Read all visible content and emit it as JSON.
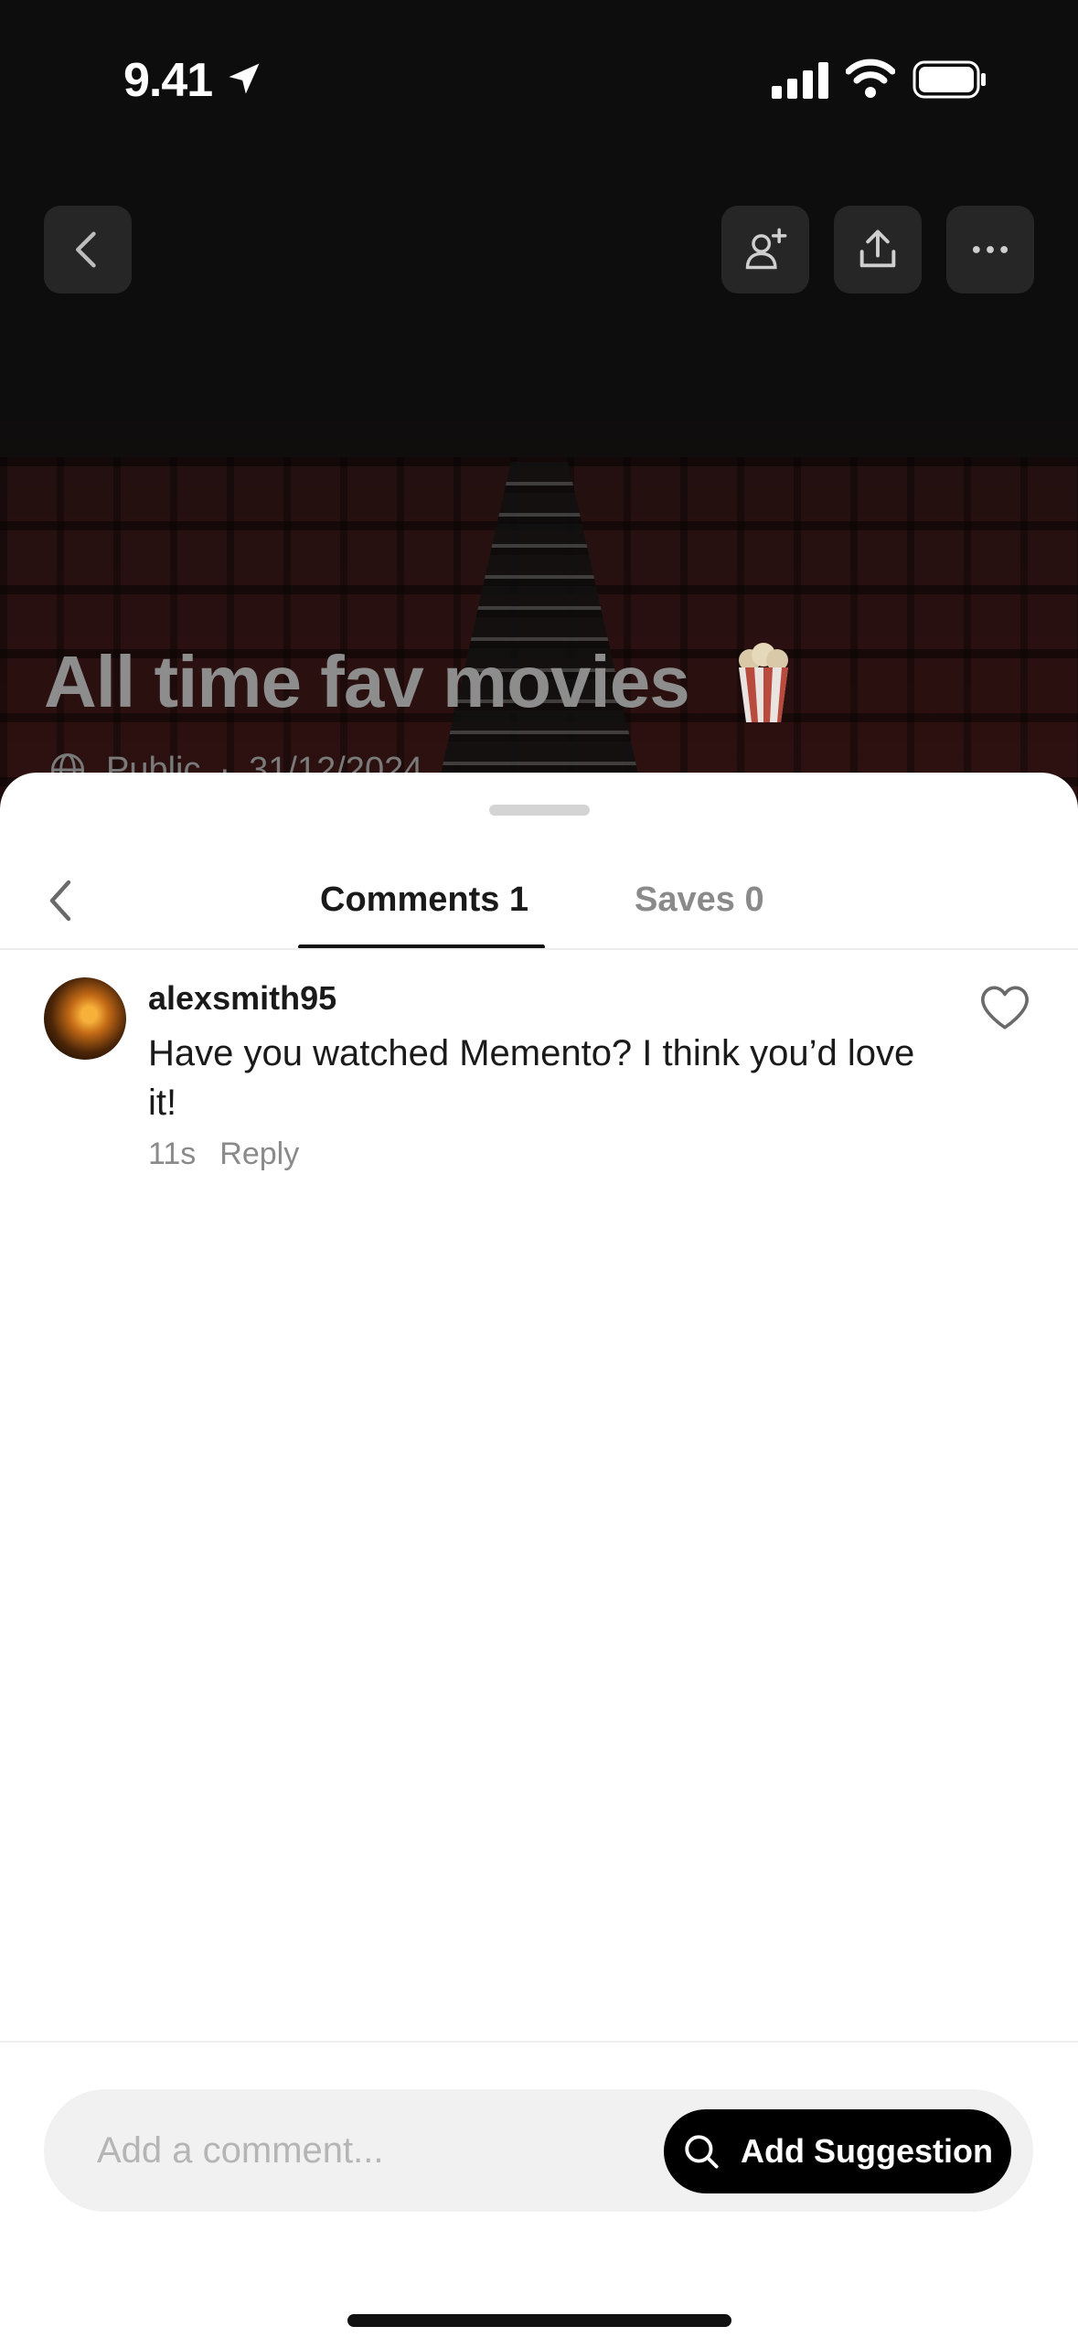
{
  "status_bar": {
    "time": "9.41"
  },
  "hero": {
    "title": "All time fav movies",
    "visibility": "Public",
    "date": "31/12/2024",
    "icons": [
      "back-icon",
      "add-person-icon",
      "share-icon",
      "more-icon",
      "popcorn-icon",
      "globe-icon"
    ]
  },
  "sheet": {
    "tabs": [
      {
        "label": "Comments 1",
        "active": true
      },
      {
        "label": "Saves 0",
        "active": false
      }
    ],
    "comments": [
      {
        "username": "alexsmith95",
        "text": "Have you watched Memento? I think you’d love it!",
        "age": "11s",
        "reply_label": "Reply"
      }
    ],
    "composer": {
      "placeholder": "Add a comment...",
      "suggest_label": "Add Suggestion"
    }
  },
  "colors": {
    "accent": "#000000",
    "sheet_bg": "#ffffff",
    "input_bg": "#f1f1f1"
  }
}
